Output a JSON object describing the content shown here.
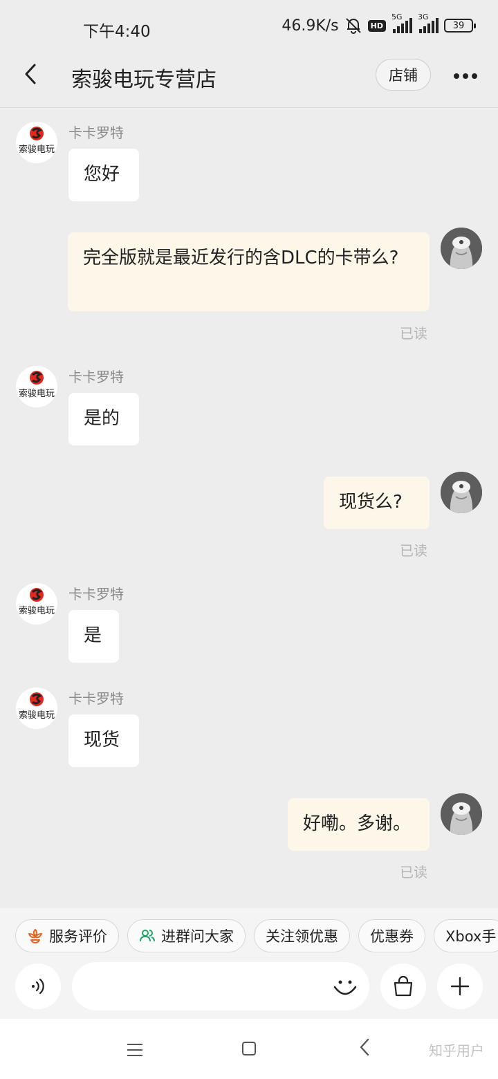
{
  "status_bar": {
    "time": "下午4:40",
    "net_speed": "46.9K/s",
    "hd": "HD",
    "sim1": "5G",
    "sim2": "3G",
    "battery": "39"
  },
  "header": {
    "title": "索骏电玩专营店",
    "shop_button": "店铺"
  },
  "shop_logo_text": "索骏电玩",
  "messages": [
    {
      "side": "left",
      "sender": "卡卡罗特",
      "text": "您好"
    },
    {
      "side": "right",
      "text": "完全版就是最近发行的含DLC的卡带么?",
      "status": "已读"
    },
    {
      "side": "left",
      "sender": "卡卡罗特",
      "text": "是的"
    },
    {
      "side": "right",
      "text": "现货么?",
      "status": "已读"
    },
    {
      "side": "left",
      "sender": "卡卡罗特",
      "text": "是"
    },
    {
      "side": "left",
      "sender": "卡卡罗特",
      "text": "现货"
    },
    {
      "side": "right",
      "text": "好嘞。多谢。",
      "status": "已读"
    }
  ],
  "quick_actions": [
    {
      "label": "服务评价",
      "icon": "flower-icon"
    },
    {
      "label": "进群问大家",
      "icon": "group-icon"
    },
    {
      "label": "关注领优惠",
      "icon": ""
    },
    {
      "label": "优惠券",
      "icon": ""
    },
    {
      "label": "Xbox手",
      "icon": ""
    }
  ],
  "watermark": "知乎用户",
  "colors": {
    "background": "#ededed",
    "left_bubble": "#ffffff",
    "right_bubble": "#fdf7e9",
    "read_text": "#b5b5b5",
    "logo_red": "#e0281e"
  }
}
